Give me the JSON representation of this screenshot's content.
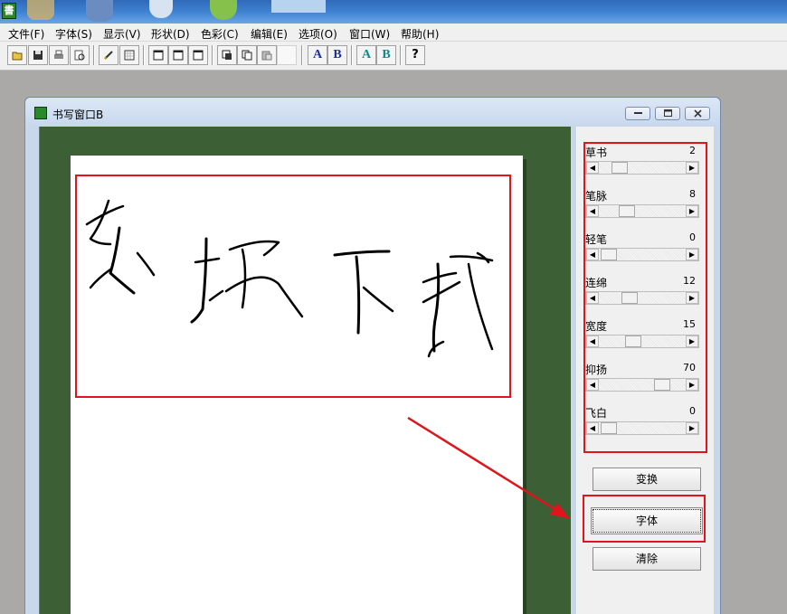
{
  "app": {
    "icon_glyph": "書"
  },
  "menu": [
    {
      "id": "file",
      "label": "文件(F)"
    },
    {
      "id": "font",
      "label": "字体(S)"
    },
    {
      "id": "view",
      "label": "显示(V)"
    },
    {
      "id": "shape",
      "label": "形状(D)"
    },
    {
      "id": "color",
      "label": "色彩(C)"
    },
    {
      "id": "edit",
      "label": "编辑(E)"
    },
    {
      "id": "options",
      "label": "选项(O)"
    },
    {
      "id": "window",
      "label": "窗口(W)"
    },
    {
      "id": "help",
      "label": "帮助(H)"
    }
  ],
  "toolbar": {
    "icons": [
      "open-folder-icon",
      "save-icon",
      "print-icon",
      "print-preview-icon",
      "pen-icon",
      "grid-icon",
      "window-1-icon",
      "window-2-icon",
      "window-3-icon",
      "cut-icon",
      "copy-icon",
      "paste-icon",
      "blank-icon"
    ],
    "a_blue_label": "A",
    "b_blue_label": "B",
    "a_teal_label": "A",
    "b_teal_label": "B",
    "help_label": "?"
  },
  "child_window": {
    "title": "书写窗口B",
    "handwritten_text": "东坡下载"
  },
  "sliders": [
    {
      "label": "草书",
      "value": "2",
      "thumb_fraction": 0.18
    },
    {
      "label": "笔脉",
      "value": "8",
      "thumb_fraction": 0.28
    },
    {
      "label": "轻笔",
      "value": "0",
      "thumb_fraction": 0.02
    },
    {
      "label": "连绵",
      "value": "12",
      "thumb_fraction": 0.32
    },
    {
      "label": "宽度",
      "value": "15",
      "thumb_fraction": 0.37
    },
    {
      "label": "抑扬",
      "value": "70",
      "thumb_fraction": 0.78
    },
    {
      "label": "飞白",
      "value": "0",
      "thumb_fraction": 0.02
    }
  ],
  "buttons": {
    "convert": "变换",
    "font": "字体",
    "clear": "清除"
  },
  "colors": {
    "annotation": "#e0141b",
    "canvas_green": "#3c5f36",
    "ab_blue": "#1a2d9e",
    "ab_teal": "#0a8a8a"
  }
}
